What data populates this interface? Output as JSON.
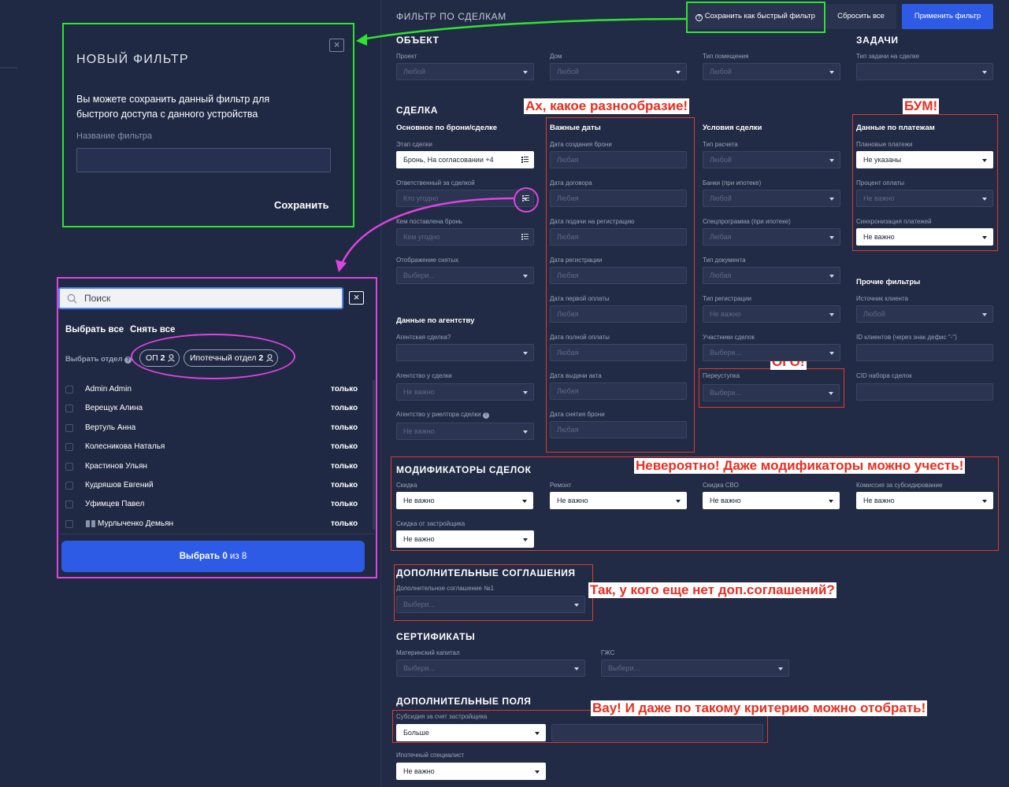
{
  "header": {
    "title": "ФИЛЬТР ПО СДЕЛКАМ",
    "save_quick": "Сохранить как быстрый фильтр",
    "reset": "Сбросить все",
    "apply": "Применить фильтр"
  },
  "modal": {
    "title": "НОВЫЙ ФИЛЬТР",
    "desc": "Вы можете сохранить данный фильтр для быстрого доступа с данного устройства",
    "name_label": "Название фильтра",
    "save": "Сохранить"
  },
  "picker": {
    "search_placeholder": "Поиск",
    "select_all": "Выбрать все",
    "deselect_all": "Снять все",
    "dept_label": "Выбрать отдел",
    "depts": [
      {
        "name": "ОП",
        "count": "2"
      },
      {
        "name": "Ипотечный отдел",
        "count": "2"
      }
    ],
    "only_label": "только",
    "users": [
      "Admin Admin",
      "Верещук Алина",
      "Вертуль Анна",
      "Колесникова Наталья",
      "Крастинов Ульян",
      "Кудряшов Евгений",
      "Уфимцев Павел",
      "Мурлыченко Демьян"
    ],
    "choose": "Выбрать",
    "choose_count": "0",
    "of": "из",
    "total": "8"
  },
  "object": {
    "title": "ОБЪЕКТ",
    "project_label": "Проект",
    "project_value": "Любой",
    "house_label": "Дом",
    "house_value": "Любой",
    "room_label": "Тип помещения",
    "room_value": "Любой"
  },
  "tasks": {
    "title": "ЗАДАЧИ",
    "type_label": "Тип задачи на сделке",
    "type_value": ""
  },
  "deal": {
    "title": "СДЕЛКА",
    "main_title": "Основное по брони/сделке",
    "stage_label": "Этап сделки",
    "stage_value": "Бронь, На согласовании +4",
    "resp_label": "Ответственный за сделкой",
    "resp_value": "Кто угодно",
    "placed_label": "Кем поставлена бронь",
    "placed_value": "Кем угодно",
    "display_label": "Отображение снятых",
    "display_value": "Выбери...",
    "dates_title": "Важные даты",
    "dates": [
      {
        "label": "Дата создания брони",
        "value": "Любая"
      },
      {
        "label": "Дата договора",
        "value": "Любая"
      },
      {
        "label": "Дата подачи на регистрацию",
        "value": "Любая"
      },
      {
        "label": "Дата регистрации",
        "value": "Любая"
      },
      {
        "label": "Дата первой оплаты",
        "value": "Любая"
      },
      {
        "label": "Дата полной оплаты",
        "value": "Любая"
      },
      {
        "label": "Дата выдачи акта",
        "value": "Любая"
      },
      {
        "label": "Дата снятия брони",
        "value": "Любая"
      }
    ],
    "cond_title": "Условия сделки",
    "cond": [
      {
        "label": "Тип расчета",
        "value": "Любой"
      },
      {
        "label": "Банки (при ипотеке)",
        "value": "Любой"
      },
      {
        "label": "Спецпрограмма (при ипотеке)",
        "value": "Любая"
      },
      {
        "label": "Тип документа",
        "value": "Любая"
      },
      {
        "label": "Тип регистрации",
        "value": "Не важно"
      },
      {
        "label": "Участники сделок",
        "value": "Выбери..."
      }
    ],
    "cession_label": "Переуступка",
    "cession_value": "Выбери...",
    "pay_title": "Данные по платежам",
    "pay": [
      {
        "label": "Плановые платежи",
        "value": "Не указаны"
      },
      {
        "label": "Процент оплаты",
        "value": "Не важно"
      },
      {
        "label": "Синхронизация платежей",
        "value": "Не важно"
      }
    ],
    "other_title": "Прочие фильтры",
    "source_label": "Источник клиента",
    "source_value": "Любой",
    "ids_label": "ID клиентов (через знак дефис \"-\")",
    "ids_value": "",
    "cid_label": "CID набора сделок",
    "cid_value": "",
    "agency_title": "Данные по агентству",
    "agency": [
      {
        "label": "Агентская сделка?",
        "value": ""
      },
      {
        "label": "Агентство у сделки",
        "value": "Не важно"
      },
      {
        "label": "Агентство у риелтора сделки",
        "value": "Не важно"
      }
    ]
  },
  "mods": {
    "title": "МОДИФИКАТОРЫ СДЕЛОК",
    "items": [
      {
        "label": "Скидка",
        "value": "Не важно"
      },
      {
        "label": "Ремонт",
        "value": "Не важно"
      },
      {
        "label": "Скидка СВО",
        "value": "Не важно"
      },
      {
        "label": "Комиссия за субсидирование",
        "value": "Не важно"
      },
      {
        "label": "Скидка от застройщика",
        "value": "Не важно"
      }
    ]
  },
  "agreements": {
    "title": "ДОПОЛНИТЕЛЬНЫЕ СОГЛАШЕНИЯ",
    "label": "Дополнительное соглашение №1",
    "value": "Выбери..."
  },
  "certs": {
    "title": "СЕРТИФИКАТЫ",
    "mat_label": "Материнский капитал",
    "mat_value": "Выбери...",
    "gzhs_label": "ГЖС",
    "gzhs_value": "Выбери..."
  },
  "extra": {
    "title": "ДОПОЛНИТЕЛЬНЫЕ ПОЛЯ",
    "subsidy_label": "Субсидия за счет застройщика",
    "subsidy_op": "Больше",
    "subsidy_value": "",
    "mortgage_label": "Ипотечный специалист",
    "mortgage_value": "Не важно"
  },
  "annotations": {
    "variety": "Ах, какое разнообразие!",
    "boom": "БУМ!",
    "ogo": "ОГО!",
    "mods": "Невероятно! Даже модификаторы можно учесть!",
    "agreements": "Так, у кого еще нет доп.соглашений?",
    "extra": "Вау! И даже по такому критерию можно отобрать!"
  },
  "colors": {
    "annotation_red": "#e03a2a",
    "highlight_green": "#2ee52e",
    "highlight_magenta": "#dd44e0",
    "primary_blue": "#2e5be6"
  }
}
